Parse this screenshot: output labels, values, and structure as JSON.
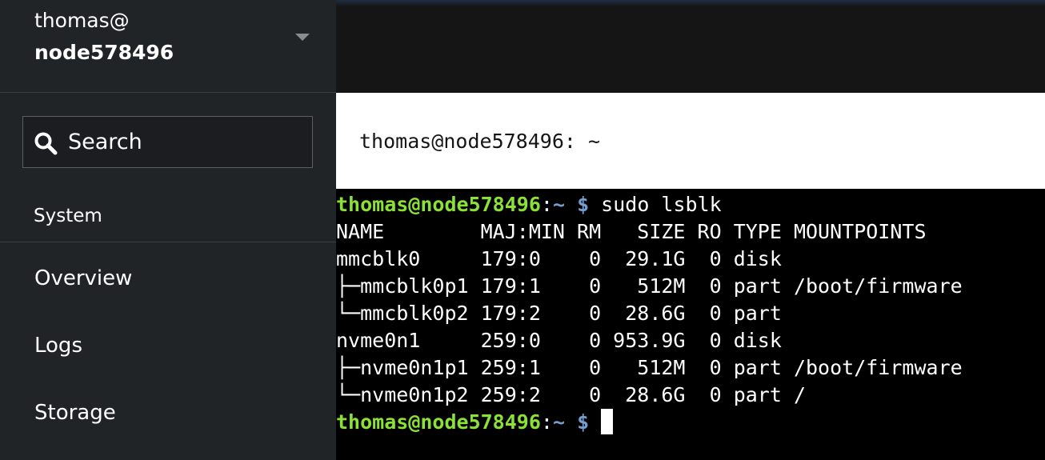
{
  "sidebar": {
    "user": "thomas@",
    "host": "node578496",
    "search_placeholder": "Search",
    "section_title": "System",
    "nav_items": [
      {
        "label": "Overview"
      },
      {
        "label": "Logs"
      },
      {
        "label": "Storage"
      }
    ]
  },
  "terminal": {
    "title": "thomas@node578496: ~",
    "prompt_user": "thomas@node578496",
    "prompt_colon": ":",
    "prompt_path": "~",
    "prompt_dollar": "$",
    "command": " sudo lsblk",
    "output_lines": [
      "NAME        MAJ:MIN RM   SIZE RO TYPE MOUNTPOINTS",
      "mmcblk0     179:0    0  29.1G  0 disk",
      "├─mmcblk0p1 179:1    0   512M  0 part /boot/firmware",
      "└─mmcblk0p2 179:2    0  28.6G  0 part",
      "nvme0n1     259:0    0 953.9G  0 disk",
      "├─nvme0n1p1 259:1    0   512M  0 part /boot/firmware",
      "└─nvme0n1p2 259:2    0  28.6G  0 part /"
    ]
  },
  "colors": {
    "sidebar_bg": "#212427",
    "prompt_user": "#8ae234",
    "prompt_path": "#729fcf",
    "terminal_bg": "#000000"
  }
}
